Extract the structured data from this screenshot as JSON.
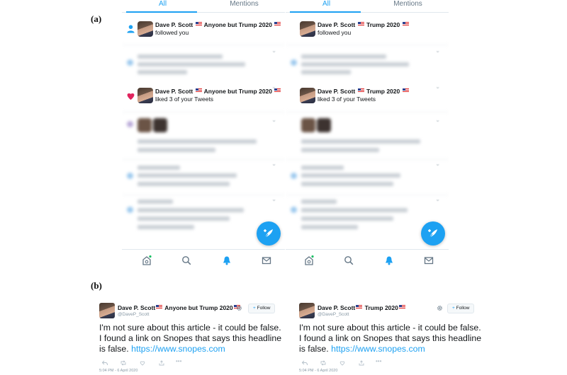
{
  "labels": {
    "a": "(a)",
    "b": "(b)"
  },
  "tabs": {
    "all": "All",
    "mentions": "Mentions"
  },
  "left_phone": {
    "follow_name": "Dave P. Scott",
    "follow_name_suffix": "Anyone but Trump 2020",
    "follow_action": "followed you",
    "like_name": "Dave P. Scott",
    "like_name_suffix": "Anyone but Trump 2020",
    "like_action": "liked 3 of your Tweets"
  },
  "right_phone": {
    "follow_name": "Dave P. Scott",
    "follow_name_suffix": "Trump 2020",
    "follow_action": "followed you",
    "like_name": "Dave P. Scott",
    "like_name_suffix": "Trump 2020",
    "like_action": "liked 3 of your Tweets"
  },
  "nav_icons": [
    "home-icon",
    "search-icon",
    "bell-icon",
    "mail-icon"
  ],
  "left_tweet": {
    "name": "Dave P. Scott",
    "name_suffix": "Anyone but Trump 2020",
    "handle": "@DaveP_Scott",
    "follow_label": "Follow",
    "text": "I'm not sure about this article - it could be false. I found a link on Snopes that says this headline is false.",
    "link": "https://www.snopes.com",
    "time": "5:04 PM - 6 April 2020"
  },
  "right_tweet": {
    "name": "Dave P. Scott",
    "name_suffix": "Trump 2020",
    "handle": "@DaveP_Scott",
    "follow_label": "Follow",
    "text": "I'm not sure about this article - it could be false. I found a link on Snopes that says this headline is false.",
    "link": "https://www.snopes.com",
    "time": "5:04 PM - 6 April 2020"
  },
  "colors": {
    "accent": "#1da1f2",
    "like": "#e0245e",
    "text": "#14171a",
    "muted": "#8899a6"
  }
}
